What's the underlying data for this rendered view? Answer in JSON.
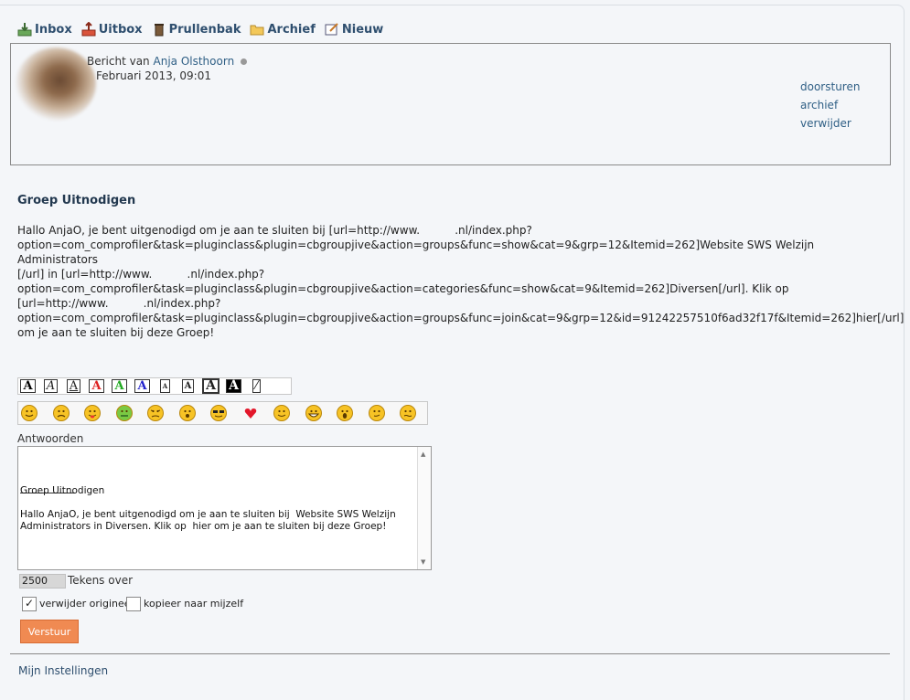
{
  "nav": {
    "inbox": "Inbox",
    "outbox": "Uitbox",
    "trash": "Prullenbak",
    "archive": "Archief",
    "new": "Nieuw"
  },
  "message": {
    "from_prefix": "Bericht van",
    "author": "Anja Olsthoorn",
    "date": "Februari 2013, 09:01",
    "actions": {
      "forward": "doorsturen",
      "archive": "archief",
      "delete": "verwijder"
    },
    "subject": "Groep Uitnodigen",
    "body": "Hallo AnjaO, je bent uitgenodigd om je aan te sluiten bij [url=http://www.          .nl/index.php?\noption=com_comprofiler&task=pluginclass&plugin=cbgroupjive&action=groups&func=show&cat=9&grp=12&Itemid=262]Website SWS Welzijn Administrators\n[/url] in [url=http://www.          .nl/index.php?\noption=com_comprofiler&task=pluginclass&plugin=cbgroupjive&action=categories&func=show&cat=9&Itemid=262]Diversen[/url]. Klik op\n[url=http://www.          .nl/index.php?\noption=com_comprofiler&task=pluginclass&plugin=cbgroupjive&action=groups&func=join&cat=9&grp=12&id=91242257510f6ad32f17f&Itemid=262]hier[/url]\nom je aan te sluiten bij deze Groep!"
  },
  "reply": {
    "label": "Antwoorden",
    "quoted_text": "Groep Uitnodigen\n\nHallo AnjaO, je bent uitgenodigd om je aan te sluiten bij  Website SWS Welzijn\nAdministrators in Diversen. Klik op  hier om je aan te sluiten bij deze Groep!",
    "chars_left": "2500",
    "chars_left_label": "Tekens over",
    "delete_original_label": "verwijder origineel",
    "delete_original_checked": true,
    "copy_self_label": "kopieer naar mijzelf",
    "copy_self_checked": false,
    "submit_label": "Verstuur"
  },
  "format_buttons": [
    "A",
    "A",
    "A",
    "A",
    "A",
    "A",
    "A",
    "A",
    "A",
    "A",
    ""
  ],
  "smileys": [
    "smile",
    "sad",
    "tongue",
    "sick",
    "angry",
    "surprised",
    "cool",
    "heart",
    "wink",
    "grin",
    "shocked",
    "blush",
    "confused"
  ],
  "colors": {
    "accent": "#2f4f6f",
    "link": "#2f5f85",
    "submit": "#f08a52"
  },
  "footer": {
    "settings": "Mijn Instellingen"
  }
}
